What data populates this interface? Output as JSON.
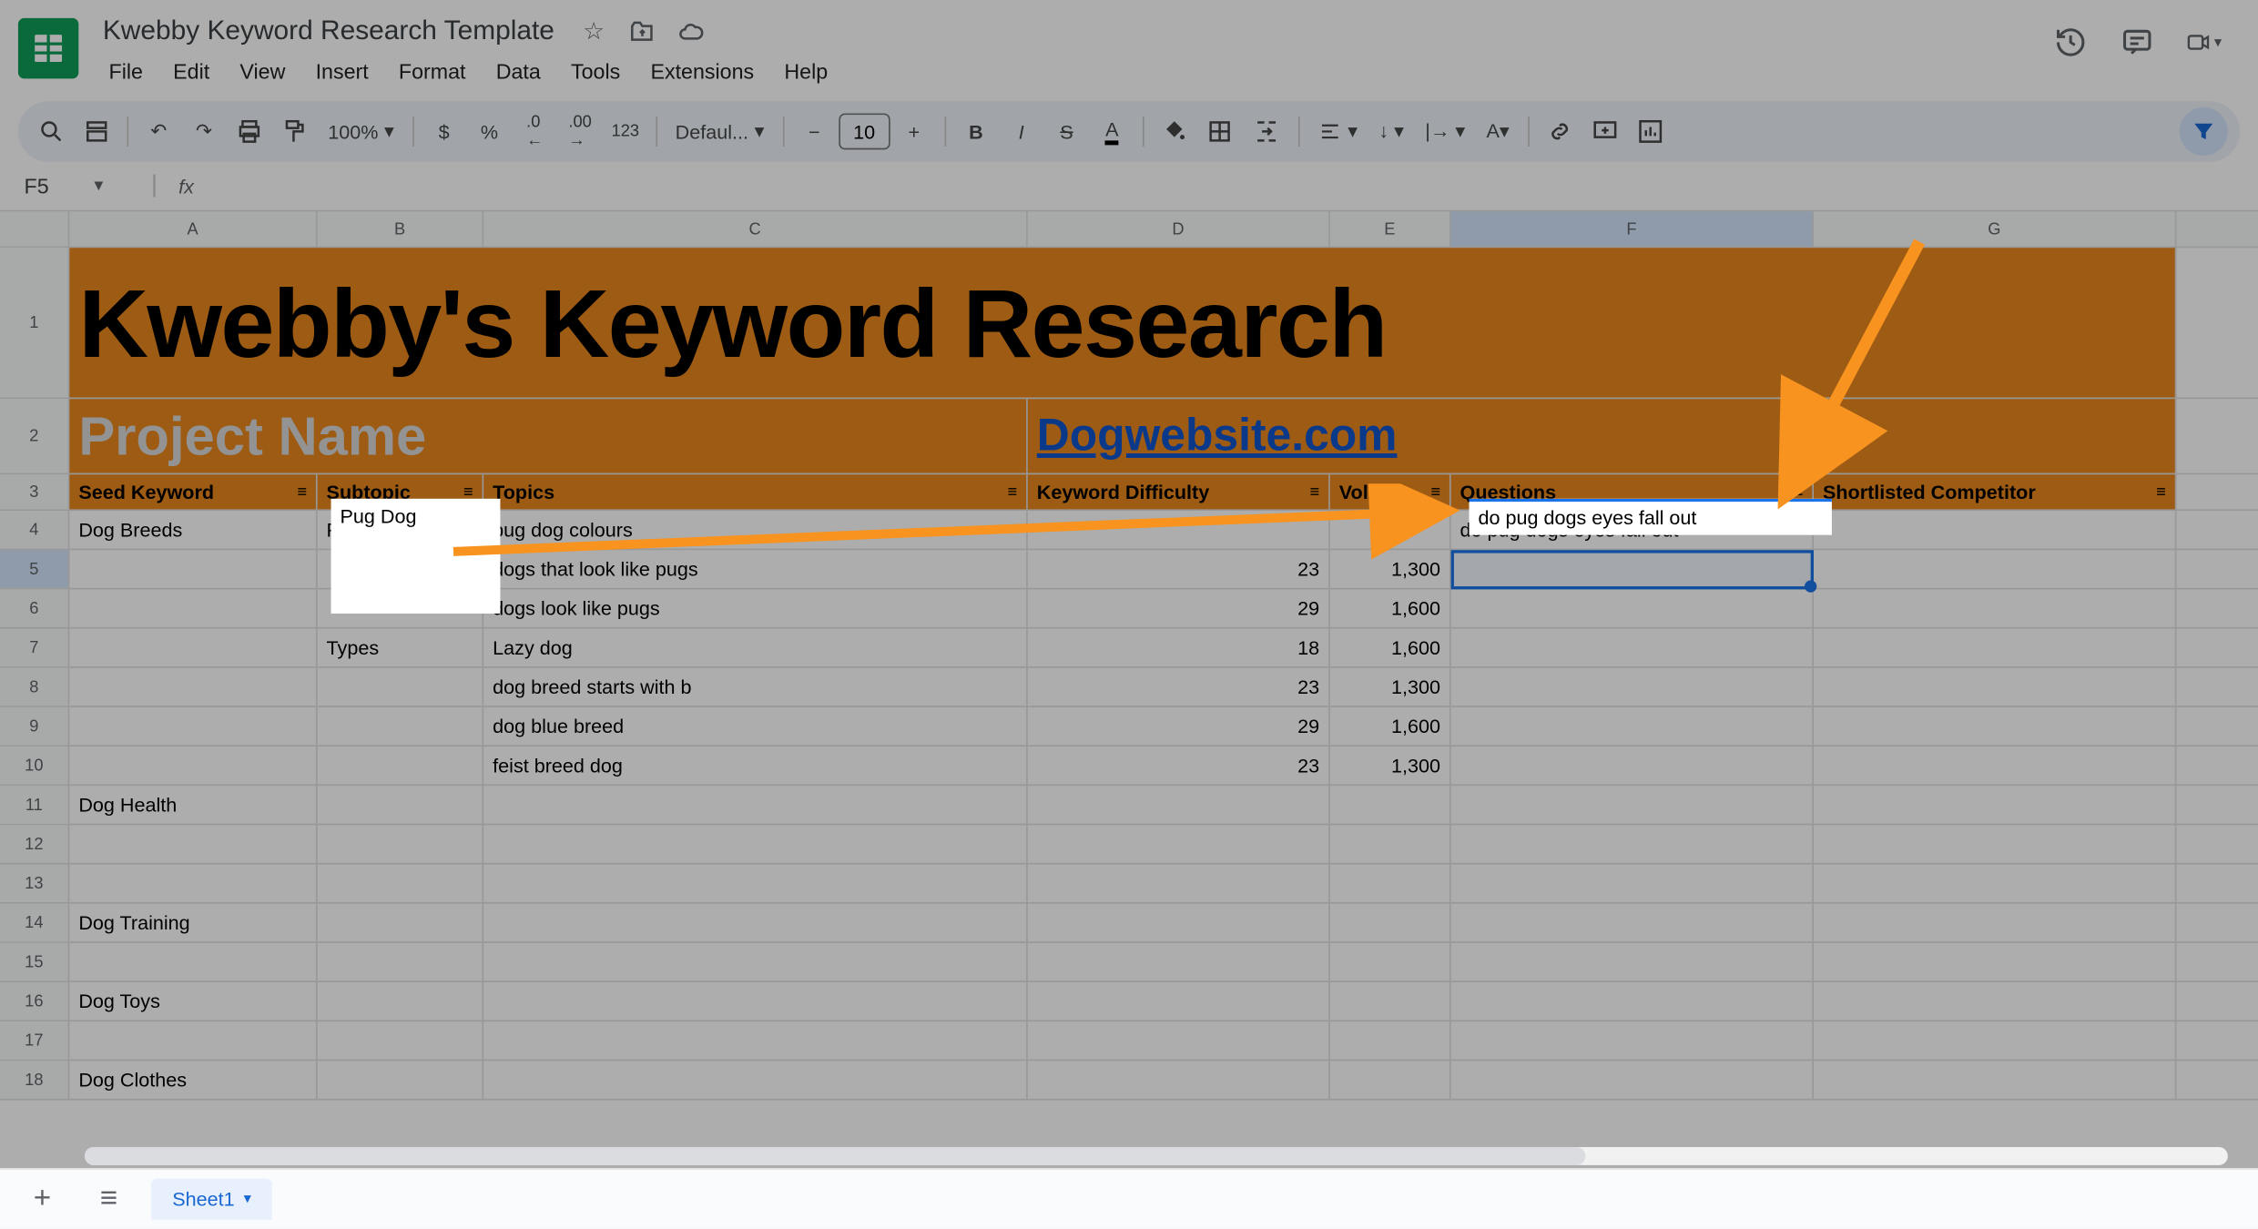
{
  "doc": {
    "title": "Kwebby Keyword Research Template"
  },
  "menu": [
    "File",
    "Edit",
    "View",
    "Insert",
    "Format",
    "Data",
    "Tools",
    "Extensions",
    "Help"
  ],
  "toolbar": {
    "zoom": "100%",
    "currency": "$",
    "percent": "%",
    "dec_dec": ".0",
    "dec_inc": ".00",
    "num123": "123",
    "font": "Defaul...",
    "fontsize": "10"
  },
  "namebox": "F5",
  "cols": [
    "A",
    "B",
    "C",
    "D",
    "E",
    "F",
    "G"
  ],
  "row1_title": "Kwebby's Keyword Research",
  "row2": {
    "label": "Project Name",
    "value": "Dogwebsite.com"
  },
  "headers": {
    "A": "Seed Keyword",
    "B": "Subtopic",
    "C": "Topics",
    "D": "Keyword Difficulty",
    "E": "Volume",
    "F": "Questions",
    "G": "Shortlisted Competitor"
  },
  "rows": [
    {
      "n": 4,
      "A": "Dog Breeds",
      "B": "Pug Dog",
      "C": "pug dog colours",
      "D": "",
      "E": "",
      "F": "do pug dogs eyes fall out"
    },
    {
      "n": 5,
      "C": "dogs that look like pugs",
      "D": "23",
      "E": "1,300"
    },
    {
      "n": 6,
      "C": "dogs look like pugs",
      "D": "29",
      "E": "1,600"
    },
    {
      "n": 7,
      "B": "Types",
      "C": "Lazy dog",
      "D": "18",
      "E": "1,600"
    },
    {
      "n": 8,
      "C": "dog breed starts with b",
      "D": "23",
      "E": "1,300"
    },
    {
      "n": 9,
      "C": "dog blue breed",
      "D": "29",
      "E": "1,600"
    },
    {
      "n": 10,
      "C": "feist breed dog",
      "D": "23",
      "E": "1,300"
    },
    {
      "n": 11,
      "A": "Dog Health"
    },
    {
      "n": 12
    },
    {
      "n": 13
    },
    {
      "n": 14,
      "A": "Dog Training"
    },
    {
      "n": 15
    },
    {
      "n": 16,
      "A": "Dog Toys"
    },
    {
      "n": 17
    },
    {
      "n": 18,
      "A": "Dog Clothes"
    }
  ],
  "tab": "Sheet1"
}
